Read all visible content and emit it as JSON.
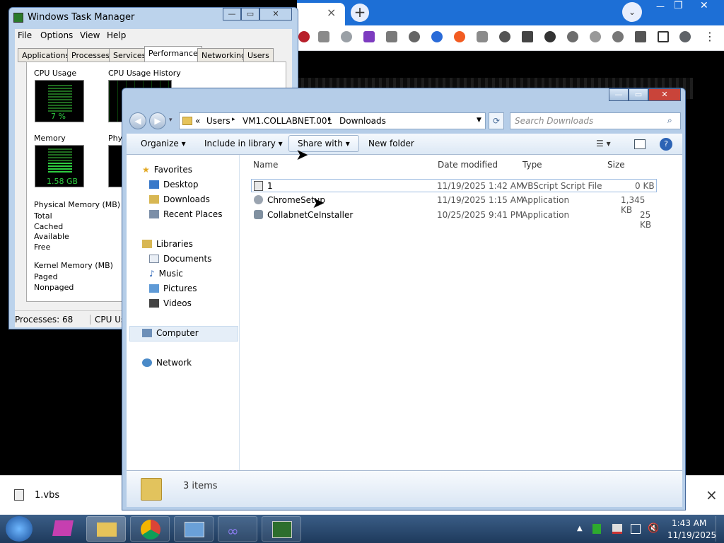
{
  "chrome": {
    "new_tab": "+",
    "tab_close": "×",
    "download_file": "1.vbs",
    "download_close": "×",
    "win_min": "—",
    "win_max": "❐",
    "win_close": "✕",
    "more": "⋮"
  },
  "taskmgr": {
    "title": "Windows Task Manager",
    "menu": [
      "File",
      "Options",
      "View",
      "Help"
    ],
    "tabs": [
      "Applications",
      "Processes",
      "Services",
      "Performance",
      "Networking",
      "Users"
    ],
    "cpu_usage_label": "CPU Usage",
    "cpu_usage_value": "7 %",
    "cpu_history_label": "CPU Usage History",
    "memory_label": "Memory",
    "memory_value": "1.58 GB",
    "phys_label": "Phys",
    "physical_memory_label": "Physical Memory (MB)",
    "phys_rows": [
      "Total",
      "Cached",
      "Available",
      "Free"
    ],
    "kernel_memory_label": "Kernel Memory (MB)",
    "kernel_rows": [
      "Paged",
      "Nonpaged"
    ],
    "status_processes": "Processes: 68",
    "status_cpu": "CPU Usa",
    "btn_min": "—",
    "btn_max": "▭",
    "btn_close": "✕"
  },
  "explorer": {
    "breadcrumb": [
      "«",
      "Users",
      "VM1.COLLABNET.001",
      "Downloads"
    ],
    "search_placeholder": "Search Downloads",
    "toolbar": {
      "organize": "Organize",
      "include_in_library": "Include in library",
      "share_with": "Share with",
      "new_folder": "New folder"
    },
    "nav": {
      "favorites": "Favorites",
      "favorite_items": [
        "Desktop",
        "Downloads",
        "Recent Places"
      ],
      "libraries": "Libraries",
      "library_items": [
        "Documents",
        "Music",
        "Pictures",
        "Videos"
      ],
      "computer": "Computer",
      "network": "Network"
    },
    "columns": [
      "Name",
      "Date modified",
      "Type",
      "Size"
    ],
    "files": [
      {
        "name": "1",
        "date": "11/19/2025 1:42 AM",
        "type": "VBScript Script File",
        "size": "0 KB"
      },
      {
        "name": "ChromeSetup",
        "date": "11/19/2025 1:15 AM",
        "type": "Application",
        "size": "1,345 KB"
      },
      {
        "name": "CollabnetCeInstaller",
        "date": "10/25/2025 9:41 PM",
        "type": "Application",
        "size": "25 KB"
      }
    ],
    "item_count": "3 items",
    "btn_min": "—",
    "btn_max": "▭",
    "btn_close": "✕"
  },
  "taskbar": {
    "time": "1:43 AM",
    "date": "11/19/2025"
  },
  "colors": {
    "chrome_blue": "#1d6fd6",
    "taskbar": "#2b4b70",
    "graph_green": "#2ecc40",
    "close_red": "#c9443a"
  }
}
